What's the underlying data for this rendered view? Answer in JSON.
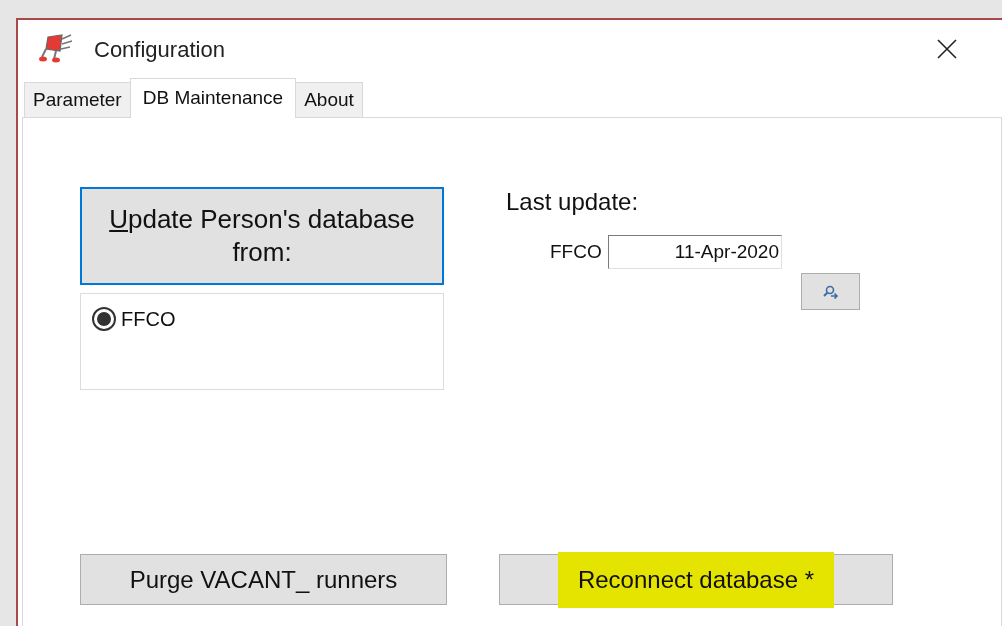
{
  "window": {
    "title": "Configuration"
  },
  "tabs": [
    {
      "label": "Parameter",
      "selected": false
    },
    {
      "label": "DB Maintenance",
      "selected": true
    },
    {
      "label": "About",
      "selected": false
    }
  ],
  "update_button": {
    "label": "Update Person's database from:"
  },
  "sources": [
    {
      "label": "FFCO",
      "selected": true
    }
  ],
  "last_update": {
    "heading": "Last update:",
    "rows": [
      {
        "label": "FFCO",
        "value": "11-Apr-2020"
      }
    ]
  },
  "buttons": [
    {
      "label": "Purge VACANT_ runners",
      "highlighted": false
    },
    {
      "label": "Reconnect database *",
      "highlighted": true
    }
  ]
}
